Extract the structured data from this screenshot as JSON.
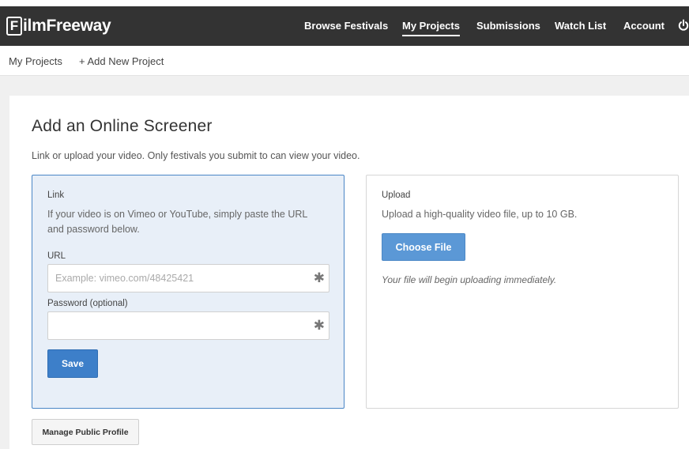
{
  "header": {
    "logo_letter": "F",
    "logo_rest": "ilmFreeway",
    "nav": [
      {
        "label": "Browse Festivals"
      },
      {
        "label": "My Projects"
      },
      {
        "label": "Submissions"
      },
      {
        "label": "Watch List"
      },
      {
        "label": "Account"
      }
    ],
    "power_icon": "power-icon"
  },
  "subnav": {
    "my_projects": "My Projects",
    "add_new": "+ Add New Project"
  },
  "main": {
    "title": "Add an Online Screener",
    "subtitle": "Link or upload your video. Only festivals you submit to can view your video.",
    "link_card": {
      "heading": "Link",
      "description": "If your video is on Vimeo or YouTube, simply paste the URL and password below.",
      "url_label": "URL",
      "url_placeholder": "Example: vimeo.com/48425421",
      "url_value": "",
      "password_label": "Password (optional)",
      "password_value": "",
      "required_mark": "✱",
      "save_label": "Save"
    },
    "upload_card": {
      "heading": "Upload",
      "description": "Upload a high-quality video file, up to 10 GB.",
      "choose_label": "Choose File",
      "note": "Your file will begin uploading immediately."
    },
    "manage_profile_label": "Manage Public Profile"
  },
  "colors": {
    "topbar": "#333333",
    "accent": "#3d7fc9",
    "link_card_bg": "#e8eff8"
  }
}
